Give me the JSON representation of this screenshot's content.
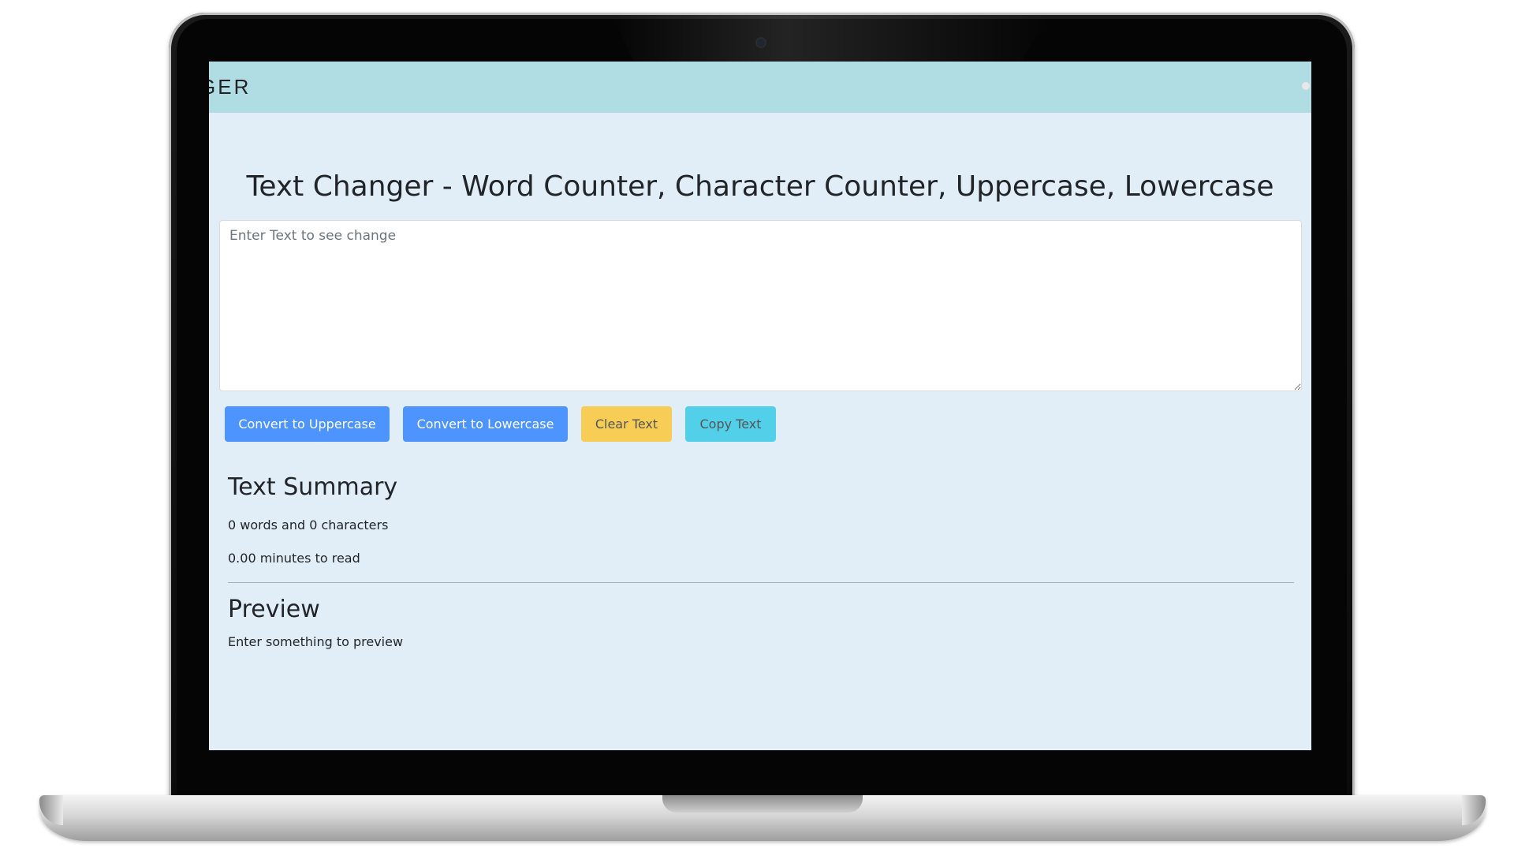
{
  "navbar": {
    "brand": "GER"
  },
  "main": {
    "title": "Text Changer - Word Counter, Character Counter, Uppercase, Lowercase",
    "textarea": {
      "placeholder": "Enter Text to see change",
      "value": ""
    },
    "buttons": {
      "uppercase": "Convert to Uppercase",
      "lowercase": "Convert to Lowercase",
      "clear": "Clear Text",
      "copy": "Copy Text"
    },
    "summary": {
      "title": "Text Summary",
      "counts": "0 words and 0 characters",
      "read_time": "0.00 minutes to read"
    },
    "preview": {
      "title": "Preview",
      "text": "Enter something to preview"
    }
  },
  "colors": {
    "navbar": "#b0dce4",
    "page_background": "#e2eef7",
    "primary_button": "#4d94ff",
    "warning_button": "#f7cd55",
    "info_button": "#52d0ea"
  }
}
